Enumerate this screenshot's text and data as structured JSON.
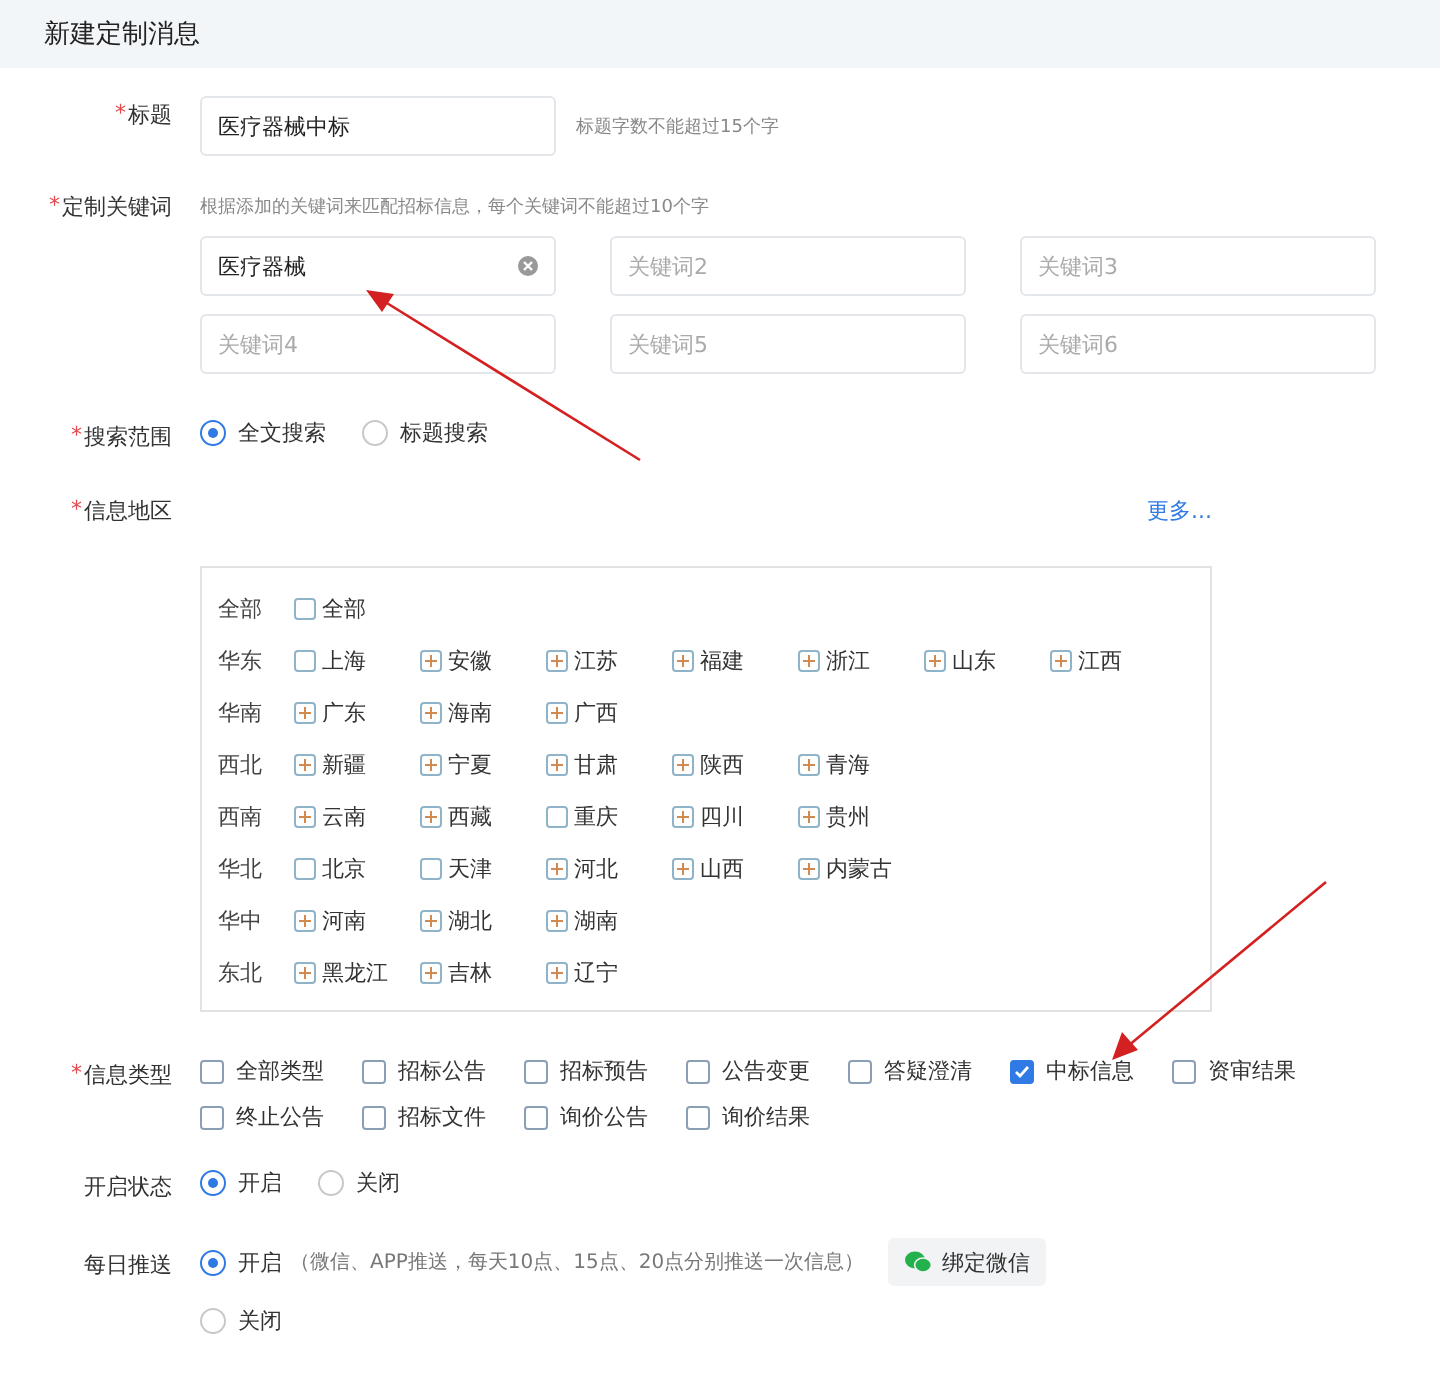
{
  "header": {
    "title": "新建定制消息"
  },
  "title_field": {
    "label": "标题",
    "marker": "*",
    "value": "医疗器械中标",
    "hint": "标题字数不能超过15个字"
  },
  "keywords": {
    "label": "定制关键词",
    "marker": "*",
    "hint": "根据添加的关键词来匹配招标信息，每个关键词不能超过10个字",
    "fields": [
      {
        "value": "医疗器械"
      },
      {
        "placeholder": "关键词2"
      },
      {
        "placeholder": "关键词3"
      },
      {
        "placeholder": "关键词4"
      },
      {
        "placeholder": "关键词5"
      },
      {
        "placeholder": "关键词6"
      }
    ]
  },
  "search_scope": {
    "label": "搜索范围",
    "marker": "*",
    "options": [
      {
        "label": "全文搜索",
        "selected": true
      },
      {
        "label": "标题搜索",
        "selected": false
      }
    ]
  },
  "region": {
    "label": "信息地区",
    "marker": "*",
    "more_link": "更多...",
    "groups": [
      {
        "name": "全部",
        "items": [
          {
            "label": "全部",
            "kind": "checkbox",
            "checked": false
          }
        ]
      },
      {
        "name": "华东",
        "items": [
          {
            "label": "上海",
            "kind": "checkbox",
            "checked": false
          },
          {
            "label": "安徽",
            "kind": "expand"
          },
          {
            "label": "江苏",
            "kind": "expand"
          },
          {
            "label": "福建",
            "kind": "expand"
          },
          {
            "label": "浙江",
            "kind": "expand"
          },
          {
            "label": "山东",
            "kind": "expand"
          },
          {
            "label": "江西",
            "kind": "expand"
          }
        ]
      },
      {
        "name": "华南",
        "items": [
          {
            "label": "广东",
            "kind": "expand"
          },
          {
            "label": "海南",
            "kind": "expand"
          },
          {
            "label": "广西",
            "kind": "expand"
          }
        ]
      },
      {
        "name": "西北",
        "items": [
          {
            "label": "新疆",
            "kind": "expand"
          },
          {
            "label": "宁夏",
            "kind": "expand"
          },
          {
            "label": "甘肃",
            "kind": "expand"
          },
          {
            "label": "陕西",
            "kind": "expand"
          },
          {
            "label": "青海",
            "kind": "expand"
          }
        ]
      },
      {
        "name": "西南",
        "items": [
          {
            "label": "云南",
            "kind": "expand"
          },
          {
            "label": "西藏",
            "kind": "expand"
          },
          {
            "label": "重庆",
            "kind": "checkbox",
            "checked": false
          },
          {
            "label": "四川",
            "kind": "expand"
          },
          {
            "label": "贵州",
            "kind": "expand"
          }
        ]
      },
      {
        "name": "华北",
        "items": [
          {
            "label": "北京",
            "kind": "checkbox",
            "checked": false
          },
          {
            "label": "天津",
            "kind": "checkbox",
            "checked": false
          },
          {
            "label": "河北",
            "kind": "expand"
          },
          {
            "label": "山西",
            "kind": "expand"
          },
          {
            "label": "内蒙古",
            "kind": "expand"
          }
        ]
      },
      {
        "name": "华中",
        "items": [
          {
            "label": "河南",
            "kind": "expand"
          },
          {
            "label": "湖北",
            "kind": "expand"
          },
          {
            "label": "湖南",
            "kind": "expand"
          }
        ]
      },
      {
        "name": "东北",
        "items": [
          {
            "label": "黑龙江",
            "kind": "expand"
          },
          {
            "label": "吉林",
            "kind": "expand"
          },
          {
            "label": "辽宁",
            "kind": "expand"
          }
        ]
      }
    ]
  },
  "info_type": {
    "label": "信息类型",
    "marker": "*",
    "options": [
      {
        "label": "全部类型",
        "checked": false
      },
      {
        "label": "招标公告",
        "checked": false
      },
      {
        "label": "招标预告",
        "checked": false
      },
      {
        "label": "公告变更",
        "checked": false
      },
      {
        "label": "答疑澄清",
        "checked": false
      },
      {
        "label": "中标信息",
        "checked": true
      },
      {
        "label": "资审结果",
        "checked": false
      },
      {
        "label": "终止公告",
        "checked": false
      },
      {
        "label": "招标文件",
        "checked": false
      },
      {
        "label": "询价公告",
        "checked": false
      },
      {
        "label": "询价结果",
        "checked": false
      }
    ]
  },
  "status": {
    "label": "开启状态",
    "options": [
      {
        "label": "开启",
        "selected": true
      },
      {
        "label": "关闭",
        "selected": false
      }
    ]
  },
  "daily_push": {
    "label": "每日推送",
    "options": [
      {
        "label": "开启",
        "selected": true,
        "note": "（微信、APP推送，每天10点、15点、20点分别推送一次信息）",
        "button": "绑定微信"
      },
      {
        "label": "关闭",
        "selected": false
      }
    ]
  }
}
